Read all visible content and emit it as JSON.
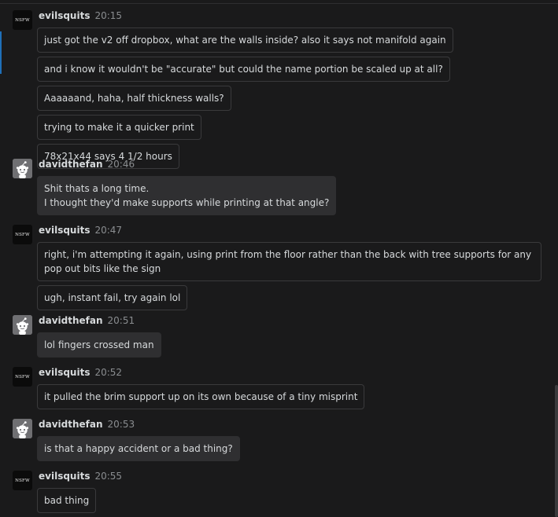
{
  "messages": [
    {
      "user": "evilsquits",
      "time": "20:15",
      "avatar": "nsfw-avatar",
      "avatar_text": "NSFW",
      "lines": [
        "just got the v2 off dropbox, what are the walls inside? also it says not manifold again",
        "and i know it wouldn't be \"accurate\" but could the name portion be scaled up at all?",
        "Aaaaaand, haha, half thickness walls?",
        "trying to make it a quicker print",
        "78x21x44 says 4 1/2 hours"
      ]
    },
    {
      "user": "davidthefan",
      "time": "20:46",
      "avatar": "robot-avatar",
      "lines": [
        "Shit thats a long time.\nI thought they'd make supports while printing at that angle?"
      ]
    },
    {
      "user": "evilsquits",
      "time": "20:47",
      "avatar": "nsfw-avatar",
      "avatar_text": "NSFW",
      "lines": [
        "right, i'm attempting it again, using print from the floor rather than the back with tree supports for any pop out bits like the sign",
        "ugh, instant fail, try again lol"
      ]
    },
    {
      "user": "davidthefan",
      "time": "20:51",
      "avatar": "robot-avatar",
      "lines": [
        "lol fingers crossed man"
      ]
    },
    {
      "user": "evilsquits",
      "time": "20:52",
      "avatar": "nsfw-avatar",
      "avatar_text": "NSFW",
      "lines": [
        "it pulled the brim support up on its own because of a tiny misprint"
      ]
    },
    {
      "user": "davidthefan",
      "time": "20:53",
      "avatar": "robot-avatar",
      "lines": [
        "is that a happy accident or a bad thing?"
      ]
    },
    {
      "user": "evilsquits",
      "time": "20:55",
      "avatar": "nsfw-avatar",
      "avatar_text": "NSFW",
      "lines": [
        "bad thing"
      ]
    }
  ],
  "colors": {
    "background": "#1a1a1b",
    "bubble_border": "#3a3a3c",
    "bubble_fill": "#2f2f31",
    "text": "#d7dadc",
    "timestamp": "#8a8d90",
    "accent": "#1f6fb8"
  }
}
